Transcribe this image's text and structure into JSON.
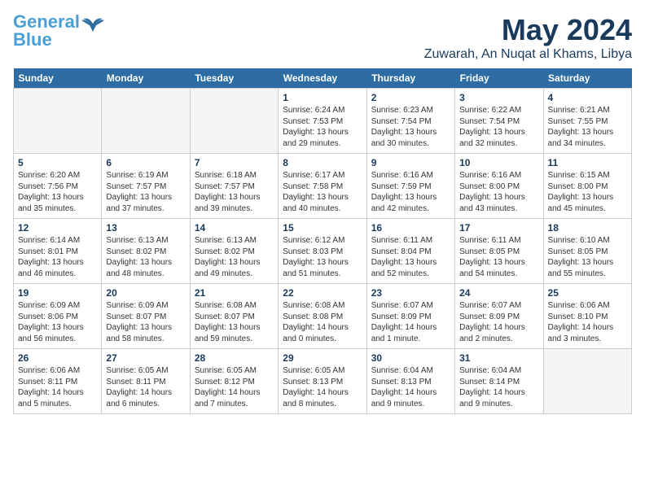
{
  "logo": {
    "line1": "General",
    "line2": "Blue"
  },
  "title": "May 2024",
  "location": "Zuwarah, An Nuqat al Khams, Libya",
  "headers": [
    "Sunday",
    "Monday",
    "Tuesday",
    "Wednesday",
    "Thursday",
    "Friday",
    "Saturday"
  ],
  "weeks": [
    [
      {
        "day": "",
        "info": ""
      },
      {
        "day": "",
        "info": ""
      },
      {
        "day": "",
        "info": ""
      },
      {
        "day": "1",
        "info": "Sunrise: 6:24 AM\nSunset: 7:53 PM\nDaylight: 13 hours\nand 29 minutes."
      },
      {
        "day": "2",
        "info": "Sunrise: 6:23 AM\nSunset: 7:54 PM\nDaylight: 13 hours\nand 30 minutes."
      },
      {
        "day": "3",
        "info": "Sunrise: 6:22 AM\nSunset: 7:54 PM\nDaylight: 13 hours\nand 32 minutes."
      },
      {
        "day": "4",
        "info": "Sunrise: 6:21 AM\nSunset: 7:55 PM\nDaylight: 13 hours\nand 34 minutes."
      }
    ],
    [
      {
        "day": "5",
        "info": "Sunrise: 6:20 AM\nSunset: 7:56 PM\nDaylight: 13 hours\nand 35 minutes."
      },
      {
        "day": "6",
        "info": "Sunrise: 6:19 AM\nSunset: 7:57 PM\nDaylight: 13 hours\nand 37 minutes."
      },
      {
        "day": "7",
        "info": "Sunrise: 6:18 AM\nSunset: 7:57 PM\nDaylight: 13 hours\nand 39 minutes."
      },
      {
        "day": "8",
        "info": "Sunrise: 6:17 AM\nSunset: 7:58 PM\nDaylight: 13 hours\nand 40 minutes."
      },
      {
        "day": "9",
        "info": "Sunrise: 6:16 AM\nSunset: 7:59 PM\nDaylight: 13 hours\nand 42 minutes."
      },
      {
        "day": "10",
        "info": "Sunrise: 6:16 AM\nSunset: 8:00 PM\nDaylight: 13 hours\nand 43 minutes."
      },
      {
        "day": "11",
        "info": "Sunrise: 6:15 AM\nSunset: 8:00 PM\nDaylight: 13 hours\nand 45 minutes."
      }
    ],
    [
      {
        "day": "12",
        "info": "Sunrise: 6:14 AM\nSunset: 8:01 PM\nDaylight: 13 hours\nand 46 minutes."
      },
      {
        "day": "13",
        "info": "Sunrise: 6:13 AM\nSunset: 8:02 PM\nDaylight: 13 hours\nand 48 minutes."
      },
      {
        "day": "14",
        "info": "Sunrise: 6:13 AM\nSunset: 8:02 PM\nDaylight: 13 hours\nand 49 minutes."
      },
      {
        "day": "15",
        "info": "Sunrise: 6:12 AM\nSunset: 8:03 PM\nDaylight: 13 hours\nand 51 minutes."
      },
      {
        "day": "16",
        "info": "Sunrise: 6:11 AM\nSunset: 8:04 PM\nDaylight: 13 hours\nand 52 minutes."
      },
      {
        "day": "17",
        "info": "Sunrise: 6:11 AM\nSunset: 8:05 PM\nDaylight: 13 hours\nand 54 minutes."
      },
      {
        "day": "18",
        "info": "Sunrise: 6:10 AM\nSunset: 8:05 PM\nDaylight: 13 hours\nand 55 minutes."
      }
    ],
    [
      {
        "day": "19",
        "info": "Sunrise: 6:09 AM\nSunset: 8:06 PM\nDaylight: 13 hours\nand 56 minutes."
      },
      {
        "day": "20",
        "info": "Sunrise: 6:09 AM\nSunset: 8:07 PM\nDaylight: 13 hours\nand 58 minutes."
      },
      {
        "day": "21",
        "info": "Sunrise: 6:08 AM\nSunset: 8:07 PM\nDaylight: 13 hours\nand 59 minutes."
      },
      {
        "day": "22",
        "info": "Sunrise: 6:08 AM\nSunset: 8:08 PM\nDaylight: 14 hours\nand 0 minutes."
      },
      {
        "day": "23",
        "info": "Sunrise: 6:07 AM\nSunset: 8:09 PM\nDaylight: 14 hours\nand 1 minute."
      },
      {
        "day": "24",
        "info": "Sunrise: 6:07 AM\nSunset: 8:09 PM\nDaylight: 14 hours\nand 2 minutes."
      },
      {
        "day": "25",
        "info": "Sunrise: 6:06 AM\nSunset: 8:10 PM\nDaylight: 14 hours\nand 3 minutes."
      }
    ],
    [
      {
        "day": "26",
        "info": "Sunrise: 6:06 AM\nSunset: 8:11 PM\nDaylight: 14 hours\nand 5 minutes."
      },
      {
        "day": "27",
        "info": "Sunrise: 6:05 AM\nSunset: 8:11 PM\nDaylight: 14 hours\nand 6 minutes."
      },
      {
        "day": "28",
        "info": "Sunrise: 6:05 AM\nSunset: 8:12 PM\nDaylight: 14 hours\nand 7 minutes."
      },
      {
        "day": "29",
        "info": "Sunrise: 6:05 AM\nSunset: 8:13 PM\nDaylight: 14 hours\nand 8 minutes."
      },
      {
        "day": "30",
        "info": "Sunrise: 6:04 AM\nSunset: 8:13 PM\nDaylight: 14 hours\nand 9 minutes."
      },
      {
        "day": "31",
        "info": "Sunrise: 6:04 AM\nSunset: 8:14 PM\nDaylight: 14 hours\nand 9 minutes."
      },
      {
        "day": "",
        "info": ""
      }
    ]
  ]
}
